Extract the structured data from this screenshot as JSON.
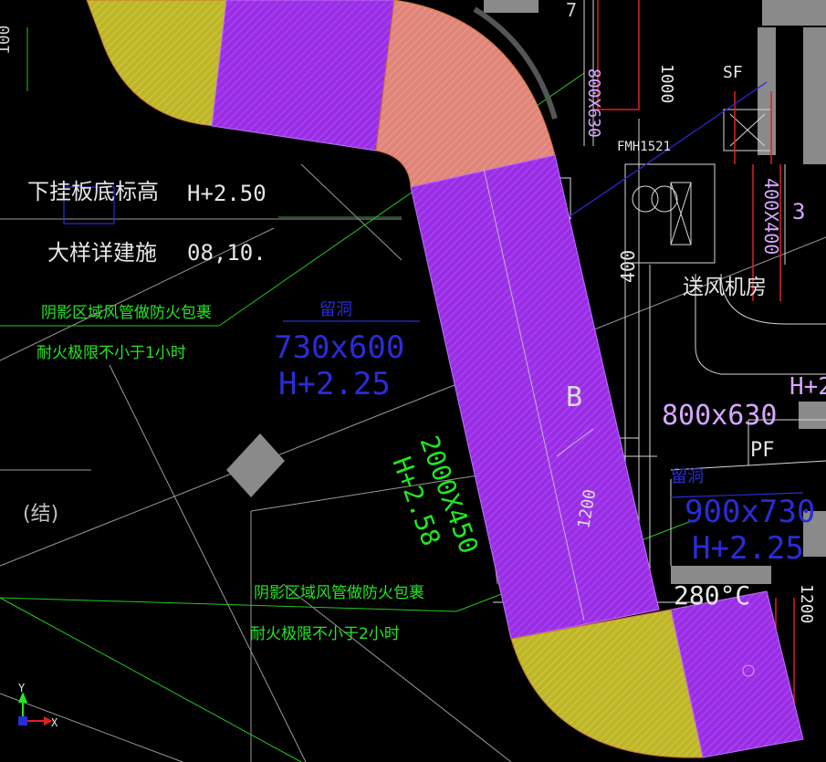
{
  "viewport": {
    "title": "CAD drawing viewport"
  },
  "labels": {
    "hang_height_title": "下挂板底标高",
    "hang_height_value": "H+2.50",
    "detail_title": "大样详建施",
    "detail_value": "08,10.",
    "fire_note_1_line1": "阴影区域风管做防火包裹",
    "fire_note_1_line2": "耐火极限不小于1小时",
    "fire_note_2_line1": "阴影区域风管做防火包裹",
    "fire_note_2_line2": "耐火极限不小于2小时",
    "opening_1_title": "留洞",
    "opening_1_size": "730x600",
    "opening_1_height": "H+2.25",
    "opening_2_title": "留洞",
    "opening_2_size": "900x730",
    "opening_2_height": "H+2.25",
    "duct_size": "2000X450",
    "duct_height": "H+2.58",
    "duct_tag": "B",
    "duct_dim": "1200",
    "struct_note": "(结)",
    "fan_room": "送风机房",
    "duct_800x630": "800x630",
    "duct_800x630_b": "800X630",
    "duct_400x400": "400X400",
    "dim_400": "400",
    "dim_1200_right": "1200",
    "damper_tag": "FMH1521",
    "sf_tag": "SF",
    "pf_tag": "PF",
    "temp_tag": "280°C",
    "h_plus": "H+2",
    "dim_1000_top": "1000",
    "dim_left_top": "100",
    "misc_7": "7",
    "misc_3": "3"
  },
  "ucs": {
    "y": "Y",
    "x": "X"
  },
  "colors": {
    "background": "#000000",
    "duct_purple": "#9a2ee6",
    "elbow_yellow": "#c8c22a",
    "elbow_salmon": "#e88c7c",
    "green_text": "#22e622",
    "blue_text": "#2b2bd9",
    "magenta_text": "#d6a6ff",
    "white_line": "#d8d8d8",
    "red_line": "#e02020"
  }
}
